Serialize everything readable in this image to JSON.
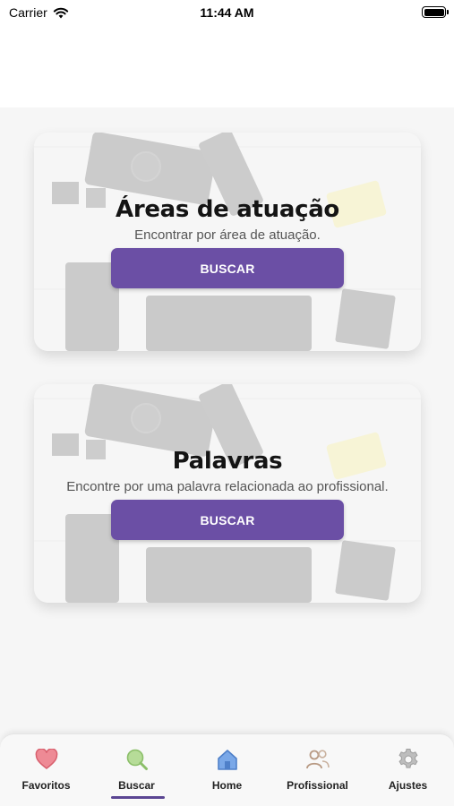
{
  "status_bar": {
    "carrier": "Carrier",
    "time": "11:44 AM"
  },
  "cards": [
    {
      "title": "Áreas de atuação",
      "subtitle": "Encontrar por área de atuação.",
      "button_label": "BUSCAR"
    },
    {
      "title": "Palavras",
      "subtitle": "Encontre por uma palavra relacionada ao profissional.",
      "button_label": "BUSCAR"
    }
  ],
  "tabbar": {
    "items": [
      {
        "label": "Favoritos",
        "icon": "heart-icon",
        "color": "#e8737f"
      },
      {
        "label": "Buscar",
        "icon": "search-icon",
        "color": "#9ccc7a",
        "active": true
      },
      {
        "label": "Home",
        "icon": "home-icon",
        "color": "#5b8ed6"
      },
      {
        "label": "Profissional",
        "icon": "people-icon",
        "color": "#b89a84"
      },
      {
        "label": "Ajustes",
        "icon": "gear-icon",
        "color": "#a9a9a9"
      }
    ]
  },
  "colors": {
    "accent": "#6b4fa5",
    "active_indicator": "#5a4592",
    "background": "#f6f6f6"
  }
}
